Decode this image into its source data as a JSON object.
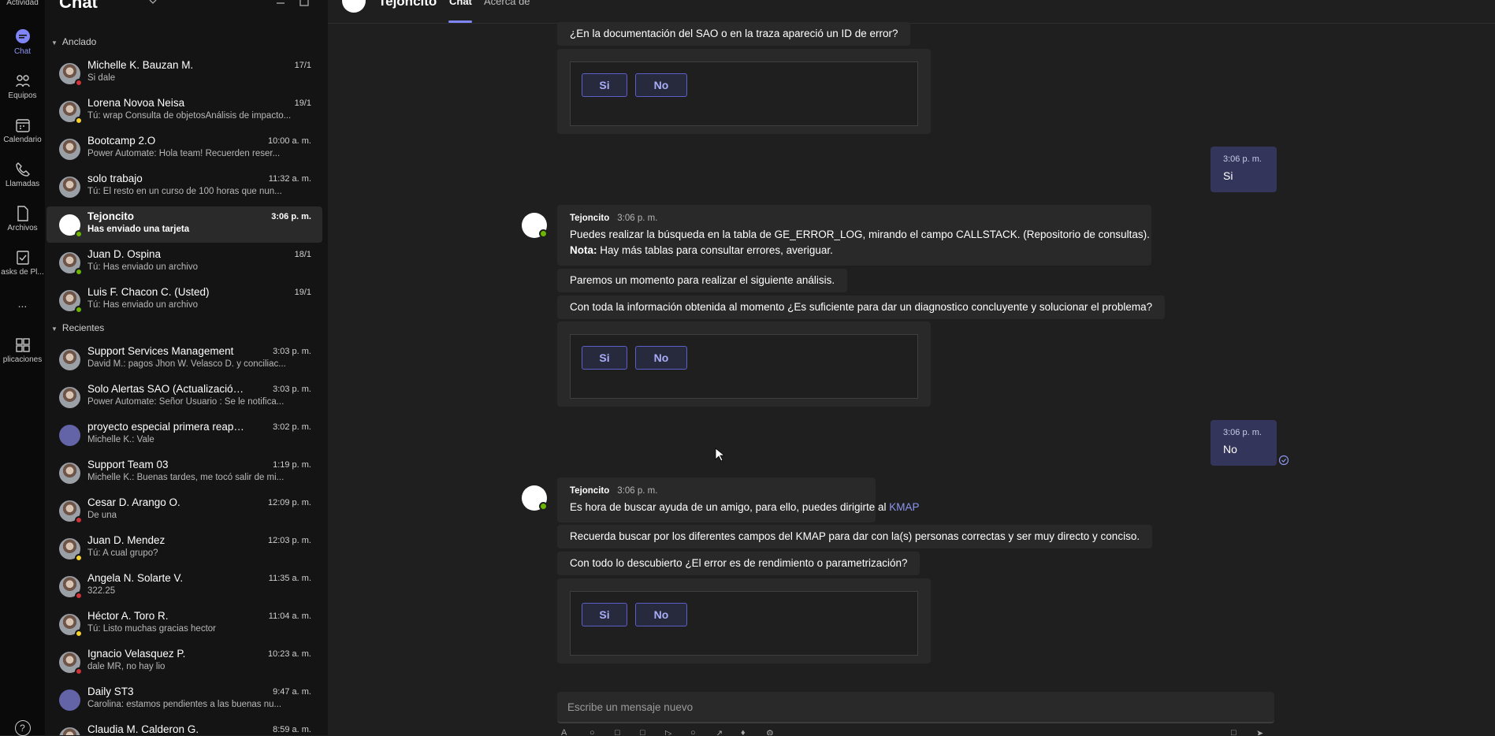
{
  "rail": {
    "items": [
      {
        "label": "Actividad"
      },
      {
        "label": "Chat"
      },
      {
        "label": "Equipos"
      },
      {
        "label": "Calendario"
      },
      {
        "label": "Llamadas"
      },
      {
        "label": "Archivos"
      },
      {
        "label": "asks de Pl..."
      },
      {
        "label": "..."
      },
      {
        "label": "plicaciones"
      },
      {
        "label": "?"
      }
    ]
  },
  "list": {
    "title": "Chat",
    "sections": {
      "pinned": "Anclado",
      "recent": "Recientes"
    },
    "pinned": [
      {
        "name": "Michelle K. Bauzan M.",
        "time": "17/1",
        "preview": "Si dale"
      },
      {
        "name": "Lorena Novoa Neisa",
        "time": "19/1",
        "preview": "Tú: wrap Consulta de objetosAnálisis de impacto..."
      },
      {
        "name": "Bootcamp 2.O",
        "time": "10:00 a. m.",
        "preview": "Power Automate: Hola team! Recuerden reser..."
      },
      {
        "name": "solo trabajo",
        "time": "11:32 a. m.",
        "preview": "Tú: El resto en un curso de 100 horas que nun..."
      },
      {
        "name": "Tejoncito",
        "time": "3:06 p. m.",
        "preview": "Has enviado una tarjeta"
      },
      {
        "name": "Juan D. Ospina",
        "time": "18/1",
        "preview": "Tú: Has enviado un archivo"
      },
      {
        "name": "Luis F. Chacon C. (Usted)",
        "time": "19/1",
        "preview": "Tú: Has enviado un archivo"
      }
    ],
    "recent": [
      {
        "name": "Support Services Management",
        "time": "3:03 p. m.",
        "preview": "David M.: pagos Jhon W. Velasco D. y conciliac..."
      },
      {
        "name": "Solo Alertas SAO (Actualización Es...",
        "time": "3:03 p. m.",
        "preview": "Power Automate: Señor Usuario : Se le notifica..."
      },
      {
        "name": "proyecto especial primera reapuesta",
        "time": "3:02 p. m.",
        "preview": "Michelle K.: Vale"
      },
      {
        "name": "Support Team 03",
        "time": "1:19 p. m.",
        "preview": "Michelle K.: Buenas tardes, me tocó salir de mi..."
      },
      {
        "name": "Cesar D. Arango O.",
        "time": "12:09 p. m.",
        "preview": "De una"
      },
      {
        "name": "Juan D. Mendez",
        "time": "12:03 p. m.",
        "preview": "Tú: A cual grupo?"
      },
      {
        "name": "Angela N. Solarte V.",
        "time": "11:35 a. m.",
        "preview": "322.25"
      },
      {
        "name": "Héctor A. Toro R.",
        "time": "11:04 a. m.",
        "preview": "Tú: Listo muchas gracias hector"
      },
      {
        "name": "Ignacio Velasquez P.",
        "time": "10:23 a. m.",
        "preview": "dale MR, no hay lio"
      },
      {
        "name": "Daily ST3",
        "time": "9:47 a. m.",
        "preview": "Carolina: estamos pendientes a las buenas nu..."
      },
      {
        "name": "Claudia M. Calderon G.",
        "time": "8:59 a. m.",
        "preview": ""
      }
    ]
  },
  "conversation": {
    "title": "Tejoncito",
    "tabs": [
      "Chat",
      "Acerca de"
    ],
    "msg_q1": "¿En la documentación del SAO o en la traza apareció un ID de error?",
    "card_yes": "Si",
    "card_no": "No",
    "self1": {
      "time": "3:06 p. m.",
      "text": "Si"
    },
    "bot_block1": {
      "sender": "Tejoncito",
      "time": "3:06 p. m.",
      "line1": "Puedes realizar la búsqueda en la tabla de GE_ERROR_LOG, mirando el campo CALLSTACK. (Repositorio de consultas).",
      "note_label": "Nota:",
      "note_text": " Hay más tablas para consultar errores, averiguar.",
      "msg2": "Paremos un momento para realizar el siguiente análisis.",
      "msg3": "Con toda la información obtenida al momento ¿Es suficiente para dar un diagnostico concluyente y solucionar el problema?"
    },
    "self2": {
      "time": "3:06 p. m.",
      "text": "No"
    },
    "bot_block2": {
      "sender": "Tejoncito",
      "time": "3:06 p. m.",
      "line1": "Es hora de buscar ayuda de un amigo, para ello, puedes dirigirte al ",
      "link": "KMAP",
      "msg2": "Recuerda buscar por los diferentes campos del KMAP para dar con la(s) personas correctas y ser muy directo y conciso.",
      "msg3": "Con todo lo descubierto ¿El error es de rendimiento o parametrización?"
    },
    "composer_placeholder": "Escribe un mensaje nuevo"
  },
  "colors": {
    "accent": "#7f85f5",
    "self_bubble": "#33355b",
    "bubble": "#292929",
    "presence_green": "#6bb700",
    "presence_red": "#d13438"
  }
}
